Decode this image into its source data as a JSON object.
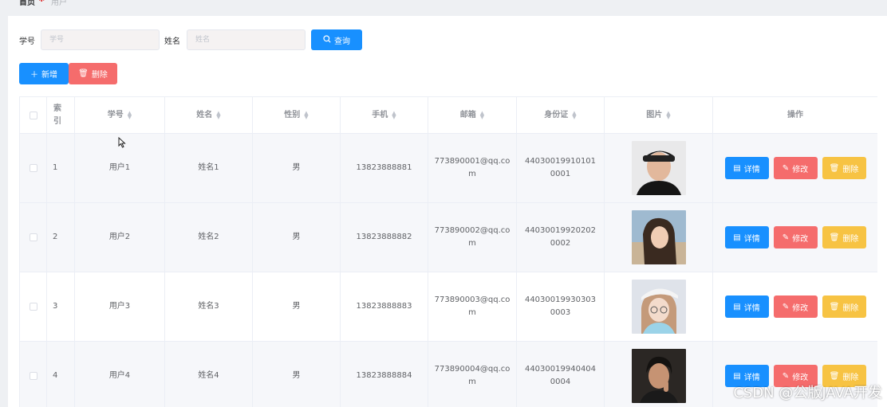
{
  "breadcrumb": {
    "home": "首页",
    "current": "用户"
  },
  "search": {
    "student_id_label": "学号",
    "student_id_placeholder": "学号",
    "name_label": "姓名",
    "name_placeholder": "姓名",
    "query_label": "查询"
  },
  "toolbar": {
    "add_label": "新增",
    "delete_label": "删除"
  },
  "table": {
    "columns": [
      "索引",
      "学号",
      "姓名",
      "性别",
      "手机",
      "邮箱",
      "身份证",
      "图片",
      "操作"
    ],
    "rows": [
      {
        "index": "1",
        "student_id": "用户1",
        "name": "姓名1",
        "gender": "男",
        "phone": "13823888881",
        "email": "773890001@qq.com",
        "id_card": "440300199101010001"
      },
      {
        "index": "2",
        "student_id": "用户2",
        "name": "姓名2",
        "gender": "男",
        "phone": "13823888882",
        "email": "773890002@qq.com",
        "id_card": "440300199202020002"
      },
      {
        "index": "3",
        "student_id": "用户3",
        "name": "姓名3",
        "gender": "男",
        "phone": "13823888883",
        "email": "773890003@qq.com",
        "id_card": "440300199303030003"
      },
      {
        "index": "4",
        "student_id": "用户4",
        "name": "姓名4",
        "gender": "男",
        "phone": "13823888884",
        "email": "773890004@qq.com",
        "id_card": "440300199404040004"
      }
    ],
    "actions": {
      "detail": "详情",
      "edit": "修改",
      "delete": "删除"
    }
  },
  "watermark": "CSDN @公版JAVA开发",
  "colors": {
    "primary": "#1890ff",
    "danger": "#f56c6c",
    "warning": "#f7c343",
    "stripe": "#f6f7fa"
  },
  "icons": {
    "query": "search-icon",
    "add": "plus-icon",
    "delete": "trash-icon",
    "detail": "document-icon",
    "edit": "pencil-icon"
  }
}
